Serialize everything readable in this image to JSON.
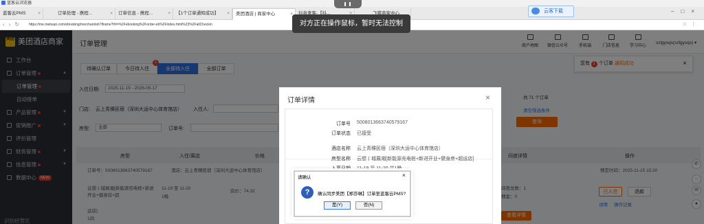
{
  "window": {
    "title": "蓝客云浏览器"
  },
  "browser": {
    "tabs": [
      {
        "label": "蓝客云PMS",
        "active": false
      },
      {
        "label": "订单处理 - 携程...",
        "active": false
      },
      {
        "label": "订单信息 - 携程...",
        "active": false
      },
      {
        "label": "【1个订单通知成功】",
        "active": false
      },
      {
        "label": "美团酒店 | 商家中心",
        "active": true
      },
      {
        "label": "抖音来客-【抖...",
        "active": false
      },
      {
        "label": "飞猪商家中心",
        "active": false
      }
    ],
    "download_button": "云客下载",
    "address": "https://me.meituan.com/ebooking/merchant/eb?iframe?ifrl=%2Febooking%2Forder-eb%2Findex.html%23%2FallCheckin"
  },
  "remote_toast": "对方正在操作鼠标，暂时无法控制",
  "sidebar": {
    "brand": "美团酒店商家",
    "logo_text": "美团",
    "items": [
      {
        "label": "工作台",
        "dot": false,
        "caret": ""
      },
      {
        "label": "订单管理",
        "dot": true,
        "caret": "▲"
      }
    ],
    "subitems": [
      {
        "label": "订单管理",
        "dot": true,
        "active": true
      },
      {
        "label": "自动接单",
        "dot": false,
        "active": false
      }
    ],
    "items2": [
      {
        "label": "产品管理",
        "dot": true,
        "caret": "▼"
      },
      {
        "label": "促销推广",
        "dot": true,
        "caret": "▼"
      },
      {
        "label": "评价管理",
        "dot": false,
        "caret": ""
      },
      {
        "label": "财务管理",
        "dot": true,
        "caret": "▼"
      },
      {
        "label": "信息管理",
        "dot": true,
        "caret": "▼"
      },
      {
        "label": "数据中心",
        "dot": false,
        "caret": "",
        "badge": "NEW"
      }
    ],
    "bottom_label": "识别经营区"
  },
  "header": {
    "title": "订单管理",
    "links": [
      "商户地图",
      "微信公众号",
      "手机端",
      "门店信息",
      "学习中心"
    ],
    "user": "szlgysqs(szlgysqs)"
  },
  "content": {
    "tabs": [
      {
        "label": "待确认订单",
        "badge": "",
        "active": false
      },
      {
        "label": "今日待入住",
        "badge": "1",
        "active": false
      },
      {
        "label": "全部待入住",
        "badge": "",
        "active": true
      },
      {
        "label": "全部订单",
        "badge": "",
        "active": false
      }
    ],
    "filters": {
      "checkin_label": "入住日期:",
      "checkin_value": "2025-11-19 - 2026-05-17",
      "store_label": "门店:",
      "store_value": "云上青稞民宿（深圳大运中心体育馆店）",
      "guest_label": "入住人:",
      "room_type_label": "房型:",
      "room_type_value": "全部",
      "order_no_label": "订单号:"
    },
    "order_count": "共 71 个订单",
    "clear_filter": "清空筛选条件",
    "search_button": "查询",
    "columns": [
      "房型",
      "入住/离店",
      "价格",
      "间夜详情",
      "操作"
    ],
    "row": {
      "order_no": "订单号：5008013663740579167",
      "hotel": "酒店：云上青稞民宿（深圳大运中心体育馆店）",
      "created": "预定时间：2025-11-15 15:20",
      "room": "云想丨城展湘[新能源充电桩+新进开业+健身房+超",
      "room2": "运店]",
      "room_count": "1间",
      "dates": "11-19 至 11-20",
      "nights": "1晚",
      "price": "房价：74.32",
      "nights_detail": "间夜总数：1",
      "nights_detail2": "佣金：0",
      "checkin_btn": "已入住",
      "refund_btn": "退款",
      "detail_link": "详情",
      "record_link": "操作记录",
      "status_btn": "查看详情"
    }
  },
  "notice": {
    "prefix": "您有",
    "count": "1",
    "middle": "个订单",
    "link": "通知成功"
  },
  "order_detail": {
    "title": "订单详情",
    "fields": [
      {
        "label": "订单号",
        "value": "5008013663740579167"
      },
      {
        "label": "订单状态",
        "value": "已接受"
      },
      {
        "label": "酒店名称",
        "value": "云上青稞民宿（深圳大运中心体育馆店）"
      },
      {
        "label": "房型名称",
        "value": "云想丨城展湘[新能源充电桩+新进开业+健身房+超运店]"
      },
      {
        "label": "入离日期",
        "value": "11-19 至 11-20 共1晚"
      }
    ]
  },
  "confirm": {
    "title": "请确认",
    "icon": "?",
    "message": "确认同步美团【郑亦琳】订单至蓝客云PMS?",
    "yes": "是(Y)",
    "no": "否(N)"
  },
  "colors": {
    "accent": "#2f6fe0",
    "orange": "#ff6a00",
    "sidebar": "#2b2f36",
    "badge": "#e5412e"
  }
}
